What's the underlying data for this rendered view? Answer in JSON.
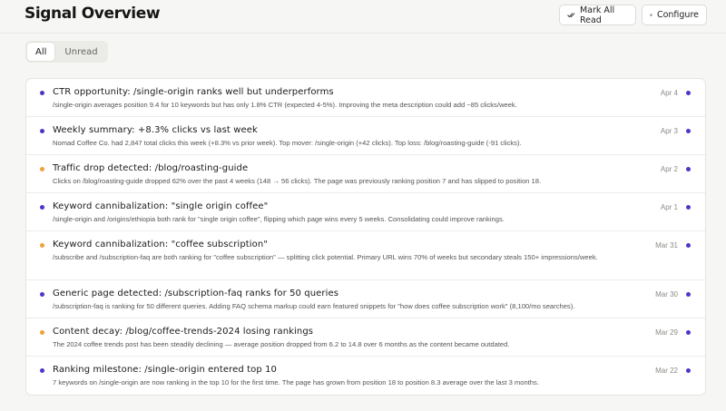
{
  "header": {
    "title": "Signal Overview",
    "mark_all_label": "Mark All Read",
    "configure_label": "Configure"
  },
  "tabs": [
    {
      "label": "All",
      "active": true
    },
    {
      "label": "Unread",
      "active": false
    }
  ],
  "colors": {
    "accent": "#4a36c9",
    "warning": "#f0a13c",
    "info": "#4a36c9"
  },
  "signals": [
    {
      "title": "CTR opportunity: /single-origin ranks well but underperforms",
      "description": "/single-origin averages position 9.4 for 10 keywords but has only 1.8% CTR (expected 4-5%). Improving the meta description could add ~85 clicks/week.",
      "date": "Apr 4",
      "severity": "info",
      "unread": true
    },
    {
      "title": "Weekly summary: +8.3% clicks vs last week",
      "description": "Nomad Coffee Co. had 2,847 total clicks this week (+8.3% vs prior week). Top mover: /single-origin (+42 clicks). Top loss: /blog/roasting-guide (-91 clicks).",
      "date": "Apr 3",
      "severity": "info",
      "unread": true
    },
    {
      "title": "Traffic drop detected: /blog/roasting-guide",
      "description": "Clicks on /blog/roasting-guide dropped 62% over the past 4 weeks (148 → 56 clicks). The page was previously ranking position 7 and has slipped to position 18.",
      "date": "Apr 2",
      "severity": "warning",
      "unread": true
    },
    {
      "title": "Keyword cannibalization: \"single origin coffee\"",
      "description": "/single-origin and /origins/ethiopia both rank for \"single origin coffee\", flipping which page wins every 5 weeks. Consolidating could improve rankings.",
      "date": "Apr 1",
      "severity": "info",
      "unread": true
    },
    {
      "title": "Keyword cannibalization: \"coffee subscription\"",
      "description": "/subscribe and /subscription-faq are both ranking for \"coffee subscription\" — splitting click potential. Primary URL wins 70% of weeks but secondary steals 150+ impressions/week.",
      "date": "Mar 31",
      "severity": "warning",
      "unread": true
    },
    {
      "title": "Generic page detected: /subscription-faq ranks for 50 queries",
      "description": "/subscription-faq is ranking for 50 different queries. Adding FAQ schema markup could earn featured snippets for \"how does coffee subscription work\" (8,100/mo searches).",
      "date": "Mar 30",
      "severity": "info",
      "unread": true
    },
    {
      "title": "Content decay: /blog/coffee-trends-2024 losing rankings",
      "description": "The 2024 coffee trends post has been steadily declining — average position dropped from 6.2 to 14.8 over 6 months as the content became outdated.",
      "date": "Mar 29",
      "severity": "warning",
      "unread": true
    },
    {
      "title": "Ranking milestone: /single-origin entered top 10",
      "description": "7 keywords on /single-origin are now ranking in the top 10 for the first time. The page has grown from position 18 to position 8.3 average over the last 3 months.",
      "date": "Mar 22",
      "severity": "info",
      "unread": true
    }
  ]
}
